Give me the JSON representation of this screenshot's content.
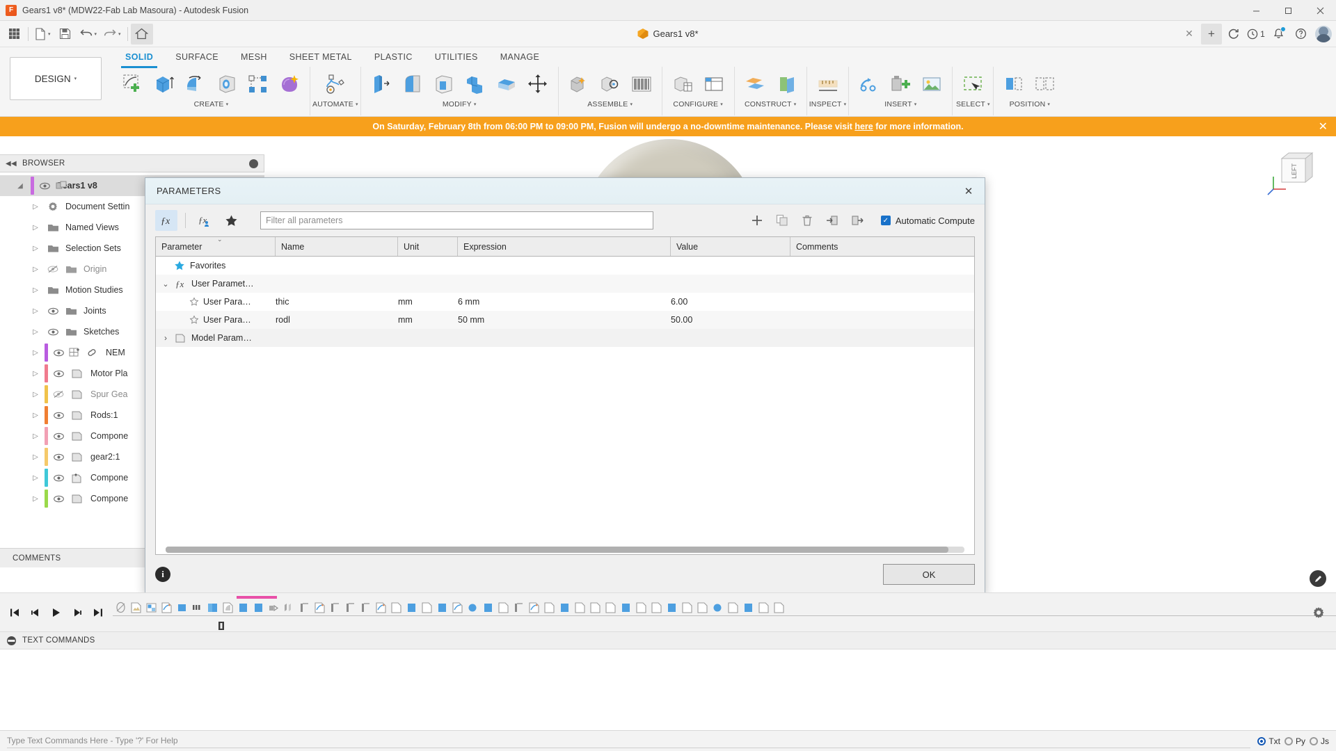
{
  "window": {
    "title": "Gears1 v8* (MDW22-Fab Lab Masoura) - Autodesk Fusion",
    "logo_letter": "F",
    "minimize": "—",
    "maximize": "□",
    "close": "✕"
  },
  "qat": {
    "grid_icon": "grid-icon",
    "new_icon": "new-document-icon",
    "save_icon": "save-icon",
    "undo_icon": "undo-icon",
    "redo_icon": "redo-icon",
    "home_icon": "home-icon",
    "doc_tab_label": "Gears1 v8*",
    "doc_tab_close": "✕",
    "add_tab": "+",
    "refresh_icon": "refresh-icon",
    "jobs_count": "1",
    "notifications_icon": "bell-icon",
    "help_icon": "help-icon",
    "account_icon": "avatar-icon"
  },
  "ribbon": {
    "workspace_label": "DESIGN",
    "workspace_caret": "▾",
    "tabs": [
      {
        "label": "SOLID",
        "active": true
      },
      {
        "label": "SURFACE",
        "active": false
      },
      {
        "label": "MESH",
        "active": false
      },
      {
        "label": "SHEET METAL",
        "active": false
      },
      {
        "label": "PLASTIC",
        "active": false
      },
      {
        "label": "UTILITIES",
        "active": false
      },
      {
        "label": "MANAGE",
        "active": false
      }
    ],
    "panels": [
      {
        "label": "CREATE",
        "caret": "▾",
        "tools": [
          "sketch-create-icon",
          "extrude-icon",
          "revolve-icon",
          "hole-icon",
          "pattern-icon",
          "form-icon"
        ]
      },
      {
        "label": "AUTOMATE",
        "caret": "▾",
        "tools": [
          "automate-frame-icon"
        ]
      },
      {
        "label": "MODIFY",
        "caret": "▾",
        "tools": [
          "press-pull-icon",
          "fillet-icon",
          "shell-icon",
          "combine-icon",
          "offset-face-icon",
          "move-copy-icon"
        ]
      },
      {
        "label": "ASSEMBLE",
        "caret": "▾",
        "tools": [
          "new-component-icon",
          "joint-icon",
          "motion-study-icon"
        ]
      },
      {
        "label": "CONFIGURE",
        "caret": "▾",
        "tools": [
          "configuration-icon",
          "config-table-icon"
        ]
      },
      {
        "label": "CONSTRUCT",
        "caret": "▾",
        "tools": [
          "offset-plane-icon",
          "plane-angle-icon"
        ]
      },
      {
        "label": "INSPECT",
        "caret": "▾",
        "tools": [
          "measure-icon"
        ]
      },
      {
        "label": "INSERT",
        "caret": "▾",
        "tools": [
          "insert-derive-icon",
          "insert-mcmaster-icon",
          "decal-icon"
        ]
      },
      {
        "label": "SELECT",
        "caret": "▾",
        "tools": [
          "select-window-icon"
        ]
      },
      {
        "label": "POSITION",
        "caret": "▾",
        "tools": [
          "position-move-icon",
          "position-align-icon"
        ]
      }
    ]
  },
  "banner": {
    "text_before": "On Saturday, February 8th from 06:00 PM to 09:00 PM, Fusion will undergo a no-downtime maintenance. Please visit ",
    "link": "here",
    "text_after": " for more information.",
    "close": "✕",
    "color": "#f7a01c"
  },
  "browser": {
    "header": "BROWSER",
    "collapse_icon": "◀◀",
    "items": [
      {
        "label": "Gears1 v8",
        "twist": "◢",
        "eye": "visible",
        "icon": "assembly-icon",
        "bar": "#c86be0",
        "root": true
      },
      {
        "label": "Document Settin",
        "twist": "▷",
        "eye": "none",
        "icon": "gear-icon",
        "bar": ""
      },
      {
        "label": "Named Views",
        "twist": "▷",
        "eye": "none",
        "icon": "folder-icon",
        "bar": ""
      },
      {
        "label": "Selection Sets",
        "twist": "▷",
        "eye": "none",
        "icon": "folder-icon",
        "bar": ""
      },
      {
        "label": "Origin",
        "twist": "▷",
        "eye": "hidden",
        "icon": "folder-icon",
        "bar": ""
      },
      {
        "label": "Motion Studies",
        "twist": "▷",
        "eye": "none",
        "icon": "folder-icon",
        "bar": ""
      },
      {
        "label": "Joints",
        "twist": "▷",
        "eye": "visible",
        "icon": "folder-icon",
        "bar": ""
      },
      {
        "label": "Sketches",
        "twist": "▷",
        "eye": "visible",
        "icon": "folder-icon",
        "bar": ""
      },
      {
        "label": "NEM",
        "twist": "▷",
        "eye": "visible",
        "icon": "linked-component-icon",
        "bar": "#b95ce0"
      },
      {
        "label": "Motor Pla",
        "twist": "▷",
        "eye": "visible",
        "icon": "component-icon",
        "bar": "#f07b8e"
      },
      {
        "label": "Spur Gea",
        "twist": "▷",
        "eye": "hidden",
        "icon": "component-icon",
        "bar": "#f0c24a"
      },
      {
        "label": "Rods:1",
        "twist": "▷",
        "eye": "visible",
        "icon": "component-icon",
        "bar": "#f07f32"
      },
      {
        "label": "Compone",
        "twist": "▷",
        "eye": "visible",
        "icon": "component-icon",
        "bar": "#f2a0b4"
      },
      {
        "label": "gear2:1",
        "twist": "▷",
        "eye": "visible",
        "icon": "component-icon",
        "bar": "#f5c96a"
      },
      {
        "label": "Compone",
        "twist": "▷",
        "eye": "visible",
        "icon": "grounded-component-icon",
        "bar": "#3fc8d8"
      },
      {
        "label": "Compone",
        "twist": "▷",
        "eye": "visible",
        "icon": "component-icon",
        "bar": "#9ad94a"
      }
    ],
    "comments_label": "COMMENTS"
  },
  "dialog": {
    "title": "PARAMETERS",
    "close": "✕",
    "toolbar": {
      "fx_button": "ƒx",
      "fx_user_button": "ƒx-user",
      "favorites_button": "★",
      "add_button": "+",
      "duplicate_button": "duplicate-icon",
      "delete_button": "trash-icon",
      "import_button": "import-icon",
      "export_button": "export-icon",
      "auto_compute_label": "Automatic Compute",
      "auto_compute_checked": true,
      "check_glyph": "✓"
    },
    "filter": {
      "placeholder": "Filter all parameters",
      "value": ""
    },
    "table": {
      "columns": [
        "Parameter",
        "Name",
        "Unit",
        "Expression",
        "Value",
        "Comments"
      ],
      "groups": [
        {
          "type": "favorites",
          "label": "Favorites",
          "icon": "star-icon",
          "twist": ""
        },
        {
          "type": "group",
          "label": "User Paramet…",
          "icon": "fx-icon",
          "twist": "⌄"
        },
        {
          "type": "group",
          "label": "Model Param…",
          "icon": "model-icon",
          "twist": "›"
        }
      ],
      "rows": [
        {
          "favorite": "☆",
          "parameter": "User Para…",
          "name": "thic",
          "unit": "mm",
          "expression": "6 mm",
          "value": "6.00",
          "comments": ""
        },
        {
          "favorite": "☆",
          "parameter": "User Para…",
          "name": "rodl",
          "unit": "mm",
          "expression": "50 mm",
          "value": "50.00",
          "comments": ""
        }
      ]
    },
    "info_icon": "i",
    "ok_label": "OK"
  },
  "timeline": {
    "go_start": "go-to-start-icon",
    "step_back": "step-back-icon",
    "play": "play-icon",
    "step_forward": "step-forward-icon",
    "go_end": "go-to-end-icon",
    "settings_icon": "gear-icon"
  },
  "text_commands": {
    "header": "TEXT COMMANDS",
    "collapse": "▬"
  },
  "command_bar": {
    "placeholder": "Type Text Commands Here - Type '?' For Help",
    "value": "",
    "modes": [
      {
        "label": "Txt",
        "selected": true
      },
      {
        "label": "Py",
        "selected": false
      },
      {
        "label": "Js",
        "selected": false
      }
    ]
  },
  "canvas": {
    "viewcube_label": "LEFT",
    "fab_icon": "pencil-icon"
  }
}
